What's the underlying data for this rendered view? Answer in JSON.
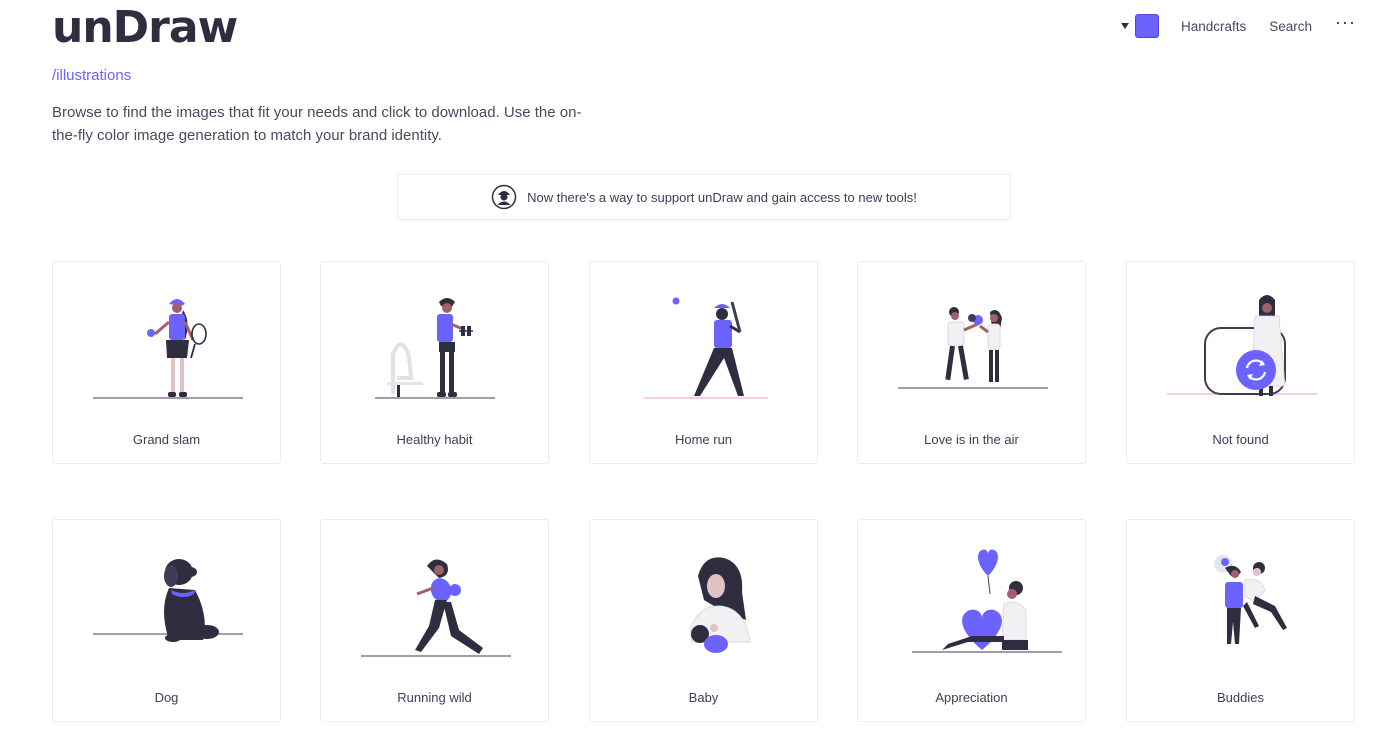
{
  "brand": {
    "name": "unDraw",
    "subtitle": "/illustrations",
    "intro": "Browse to find the images that fit your needs and click to download. Use the on-the-fly color image generation to match your brand identity."
  },
  "nav": {
    "accent_color": "#6c63ff",
    "items": [
      "Handcrafts",
      "Search"
    ],
    "more_label": "···"
  },
  "banner": {
    "text": "Now there's a way to support unDraw and gain access to new tools!",
    "icon": "supporter-avatar-icon"
  },
  "illustrations": [
    {
      "title": "Grand slam",
      "icon": "tennis-player-illustration"
    },
    {
      "title": "Healthy habit",
      "icon": "gym-workout-illustration"
    },
    {
      "title": "Home run",
      "icon": "baseball-batter-illustration"
    },
    {
      "title": "Love is in the air",
      "icon": "couple-flowers-illustration"
    },
    {
      "title": "Not found",
      "icon": "not-found-illustration"
    },
    {
      "title": "Dog",
      "icon": "dog-illustration"
    },
    {
      "title": "Running wild",
      "icon": "runner-illustration"
    },
    {
      "title": "Baby",
      "icon": "baby-illustration"
    },
    {
      "title": "Appreciation",
      "icon": "appreciation-heart-illustration"
    },
    {
      "title": "Buddies",
      "icon": "buddies-illustration"
    }
  ]
}
